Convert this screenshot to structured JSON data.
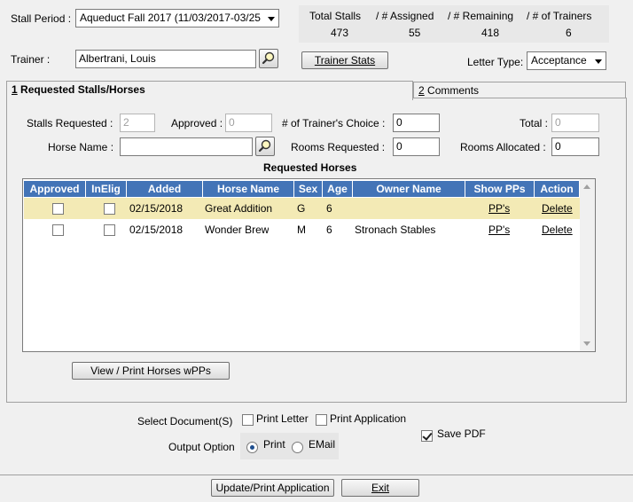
{
  "header": {
    "stall_period_label": "Stall Period :",
    "stall_period_value": "Aqueduct Fall 2017 (11/03/2017-03/25",
    "trainer_label": "Trainer :",
    "trainer_value": "Albertrani, Louis",
    "trainer_stats_button": "Trainer Stats",
    "letter_type_label": "Letter Type:",
    "letter_type_value": "Acceptance"
  },
  "stats": {
    "total_stalls_label": "Total Stalls",
    "total_stalls_value": "473",
    "assigned_label": "/ # Assigned",
    "assigned_value": "55",
    "remaining_label": "/ # Remaining",
    "remaining_value": "418",
    "trainers_label": "/ # of Trainers",
    "trainers_value": "6"
  },
  "tabs": [
    {
      "key": "1",
      "label": " Requested Stalls/Horses"
    },
    {
      "key": "2",
      "label": " Comments"
    }
  ],
  "form": {
    "stalls_requested_label": "Stalls Requested :",
    "stalls_requested_value": "2",
    "approved_label": "Approved :",
    "approved_value": "0",
    "trainers_choice_label": "# of Trainer's Choice :",
    "trainers_choice_value": "0",
    "total_label": "Total :",
    "total_value": "0",
    "horse_name_label": "Horse Name :",
    "horse_name_value": "",
    "rooms_requested_label": "Rooms Requested :",
    "rooms_requested_value": "0",
    "rooms_allocated_label": "Rooms Allocated :",
    "rooms_allocated_value": "0"
  },
  "requested_horses_title": "Requested Horses",
  "table": {
    "columns": [
      "Approved",
      "InElig",
      "Added",
      "Horse Name",
      "Sex",
      "Age",
      "Owner Name",
      "Show PPs",
      "Action"
    ],
    "rows": [
      {
        "approved": false,
        "inelig": false,
        "added": "02/15/2018",
        "horse": "Great Addition",
        "sex": "G",
        "age": "6",
        "owner": "",
        "pps": "PP's",
        "action": "Delete"
      },
      {
        "approved": false,
        "inelig": false,
        "added": "02/15/2018",
        "horse": "Wonder Brew",
        "sex": "M",
        "age": "6",
        "owner": "Stronach Stables",
        "pps": "PP's",
        "action": "Delete"
      }
    ]
  },
  "view_print_button": "View / Print Horses wPPs",
  "bottom": {
    "select_doc_label": "Select Document(S)",
    "print_letter_label": "Print Letter",
    "print_application_label": "Print Application",
    "output_option_label": "Output Option",
    "print_label": "Print",
    "email_label": "EMail",
    "save_pdf_label": "Save PDF",
    "update_button": "Update/Print Application",
    "exit_button": "Exit"
  }
}
